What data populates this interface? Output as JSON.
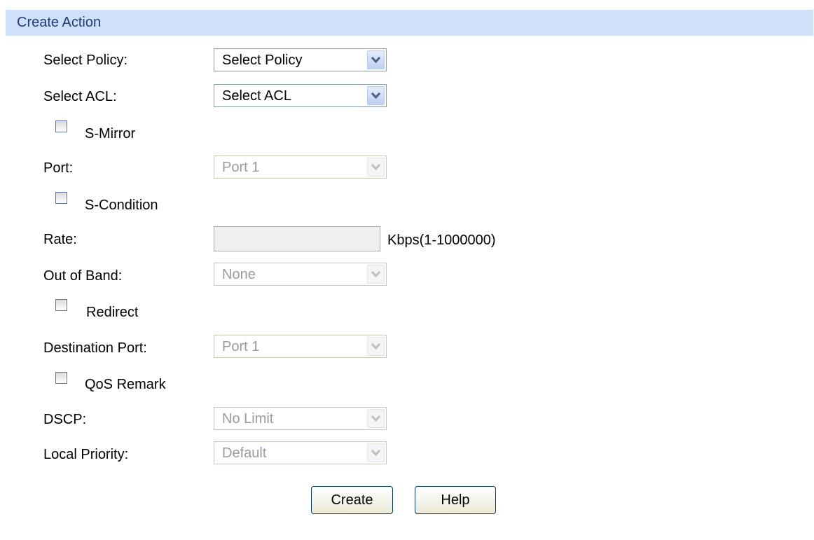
{
  "panel": {
    "title": "Create Action"
  },
  "form": {
    "select_policy": {
      "label": "Select Policy:",
      "value": "Select Policy"
    },
    "select_acl": {
      "label": "Select ACL:",
      "value": "Select ACL"
    },
    "s_mirror": {
      "label": "S-Mirror",
      "checked": false
    },
    "port": {
      "label": "Port:",
      "value": "Port 1",
      "disabled": true
    },
    "s_condition": {
      "label": "S-Condition",
      "checked": false
    },
    "rate": {
      "label": "Rate:",
      "value": "",
      "unit": "Kbps(1-1000000)"
    },
    "out_of_band": {
      "label": "Out of Band:",
      "value": "None",
      "disabled": true
    },
    "redirect": {
      "label": "Redirect",
      "checked": false
    },
    "destination_port": {
      "label": "Destination Port:",
      "value": "Port 1",
      "disabled": true
    },
    "qos_remark": {
      "label": "QoS Remark",
      "checked": false
    },
    "dscp": {
      "label": "DSCP:",
      "value": "No Limit",
      "disabled": true
    },
    "local_priority": {
      "label": "Local Priority:",
      "value": "Default",
      "disabled": true
    }
  },
  "buttons": {
    "create": "Create",
    "help": "Help"
  },
  "icons": {
    "dropdown": "chevron-down-icon"
  },
  "colors": {
    "title_bar": "#cfe0fa",
    "title_text": "#1e3c7a",
    "disabled_text": "#9b9b9b"
  }
}
